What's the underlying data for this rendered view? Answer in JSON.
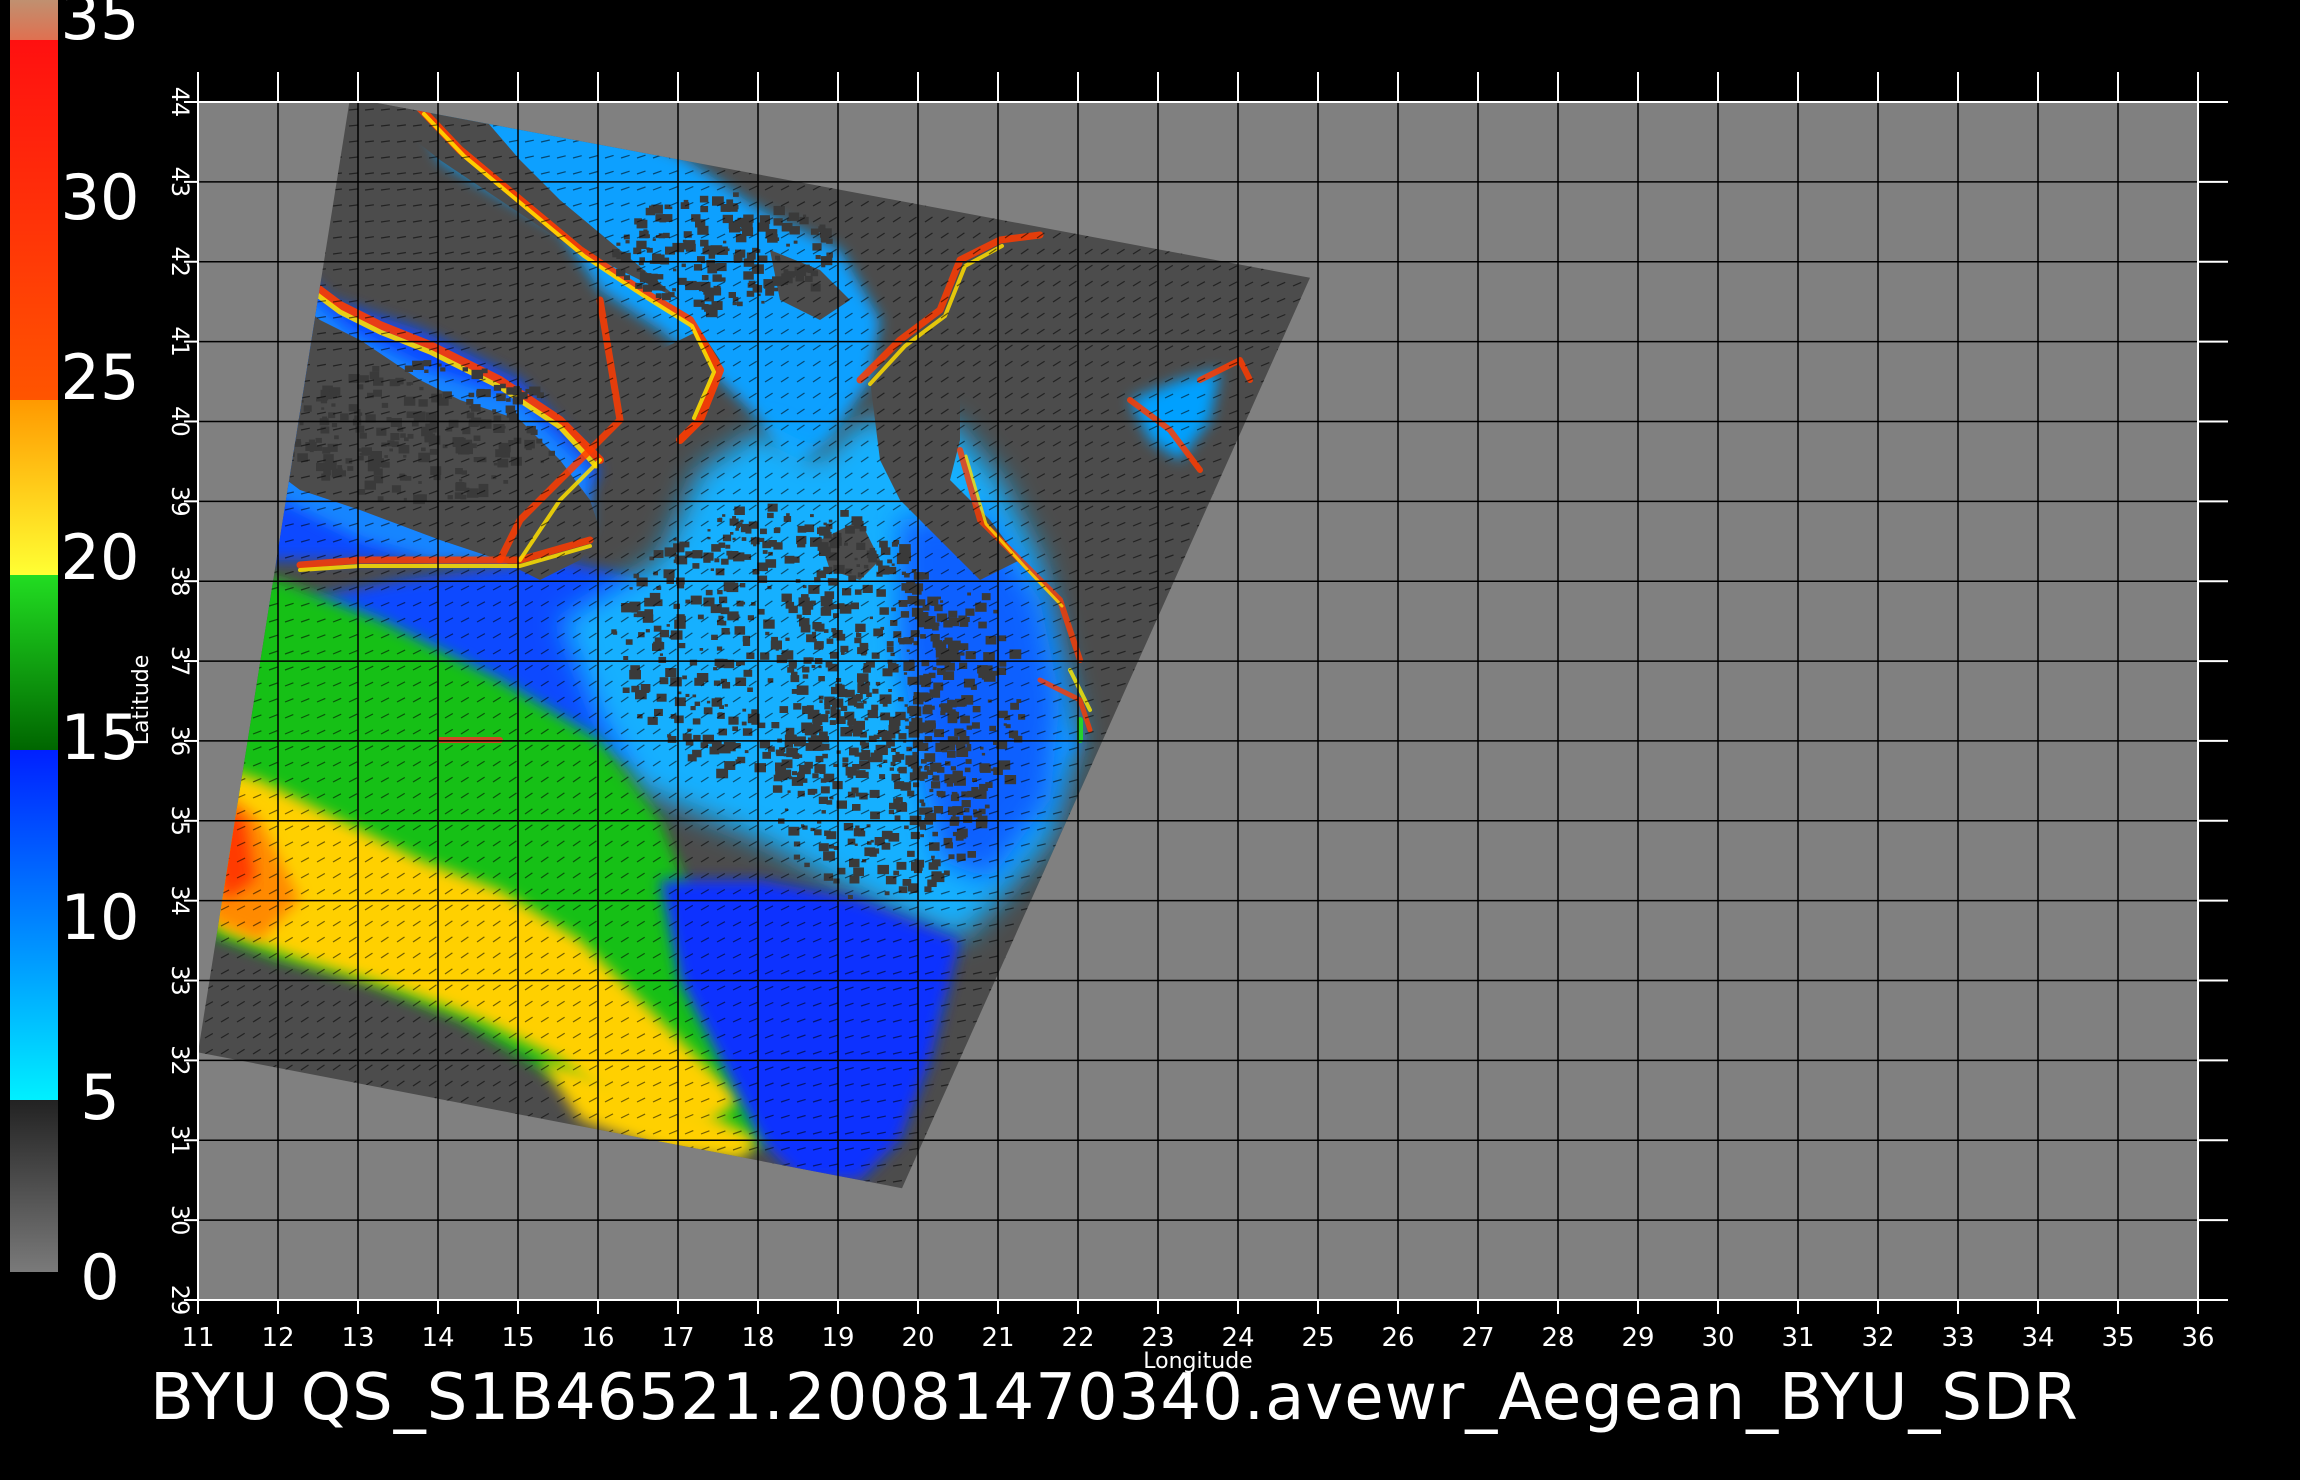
{
  "map": {
    "xlabel": "Longitude",
    "ylabel": "Latitude",
    "x_range": [
      11,
      36
    ],
    "y_range": [
      29,
      44
    ],
    "x_ticks": [
      11,
      12,
      13,
      14,
      15,
      16,
      17,
      18,
      19,
      20,
      21,
      22,
      23,
      24,
      25,
      26,
      27,
      28,
      29,
      30,
      31,
      32,
      33,
      34,
      35,
      36
    ],
    "y_ticks": [
      29,
      30,
      31,
      32,
      33,
      34,
      35,
      36,
      37,
      38,
      39,
      40,
      41,
      42,
      43,
      44
    ],
    "swath_corners_lonlat": [
      [
        12.9,
        44.05
      ],
      [
        24.9,
        41.8
      ],
      [
        19.8,
        30.4
      ],
      [
        11.0,
        32.1
      ]
    ],
    "grid": true
  },
  "colorbar": {
    "labels": [
      "35",
      "30",
      "25",
      "20",
      "15",
      "10",
      "5",
      "0"
    ],
    "values": [
      35,
      30,
      25,
      20,
      15,
      10,
      5,
      0
    ],
    "colors": {
      "gray_low": "#7a7a7a",
      "gray_high": "#2a2a2a",
      "cyan": "#00f0ff",
      "blue": "#0020ff",
      "dark_green": "#006600",
      "green": "#22dd22",
      "yellow": "#ffff33",
      "orange": "#ffbb00",
      "red_orange": "#ff5000",
      "red": "#ff2020",
      "brown": "#d09070"
    }
  },
  "colors": {
    "background": "#000000",
    "plot_bg": "#808080",
    "swath_bg": "#4c4c4c",
    "grid": "#000000",
    "land": "#4c4c4c"
  },
  "footer": {
    "title": "BYU  QS_S1B46521.20081470340.avewr_Aegean_BYU_SDR"
  }
}
